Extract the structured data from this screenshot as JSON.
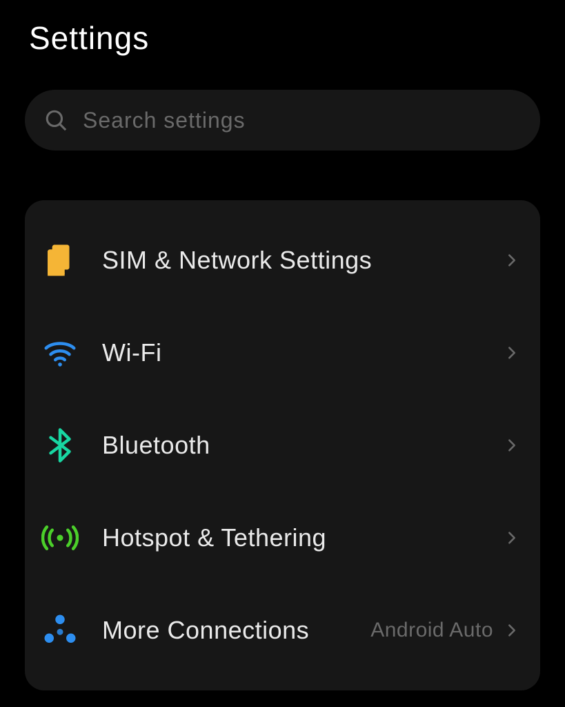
{
  "title": "Settings",
  "search": {
    "placeholder": "Search settings"
  },
  "group1": {
    "sim": {
      "label": "SIM & Network Settings"
    },
    "wifi": {
      "label": "Wi-Fi"
    },
    "bluetooth": {
      "label": "Bluetooth"
    },
    "hotspot": {
      "label": "Hotspot & Tethering"
    },
    "more": {
      "label": "More Connections",
      "value": "Android Auto"
    }
  }
}
